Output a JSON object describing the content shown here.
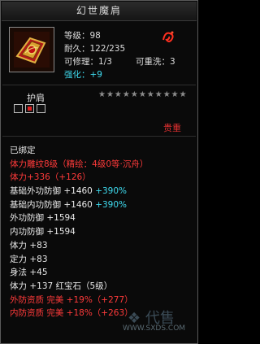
{
  "title": "幻世魔肩",
  "stats": {
    "level": "等级：98",
    "durability": "耐久：122/235",
    "repair": "可修理：1/3",
    "rewash": "可重洗：3",
    "enhance": "强化：+9"
  },
  "slot": {
    "label": "护肩",
    "stars": "★★★★★★★★★★★",
    "sockets": [
      "empty",
      "red",
      "empty"
    ]
  },
  "weight_label": "贵重",
  "lines": [
    {
      "text": "已绑定",
      "color": "white"
    },
    {
      "text": "体力雕纹8级（精绘：4级0等·沉舟）",
      "color": "red"
    },
    {
      "text": "体力+336（+126）",
      "color": "red"
    },
    {
      "text": "基础外功防御 +1460 +390%",
      "color": "white",
      "extra": "+390%"
    },
    {
      "text": "基础内功防御 +1460 +390%",
      "color": "white",
      "extra": "+390%"
    },
    {
      "text": "外功防御 +1594",
      "color": "white"
    },
    {
      "text": "内功防御 +1594",
      "color": "white"
    },
    {
      "text": "体力 +83",
      "color": "white"
    },
    {
      "text": "定力 +83",
      "color": "white"
    },
    {
      "text": "身法 +45",
      "color": "white"
    },
    {
      "text": "体力 +137 红宝石（5级）",
      "color": "white"
    },
    {
      "text": "外防资质  完美 +19%（+277）",
      "color": "red"
    },
    {
      "text": "内防资质  完美 +18%（+263）",
      "color": "red"
    }
  ],
  "watermark": "WWW.SXDS.COM",
  "colors": {
    "red": "#ff3a3a",
    "cyan": "#3fdcf0",
    "white": "#e8e8e8"
  }
}
